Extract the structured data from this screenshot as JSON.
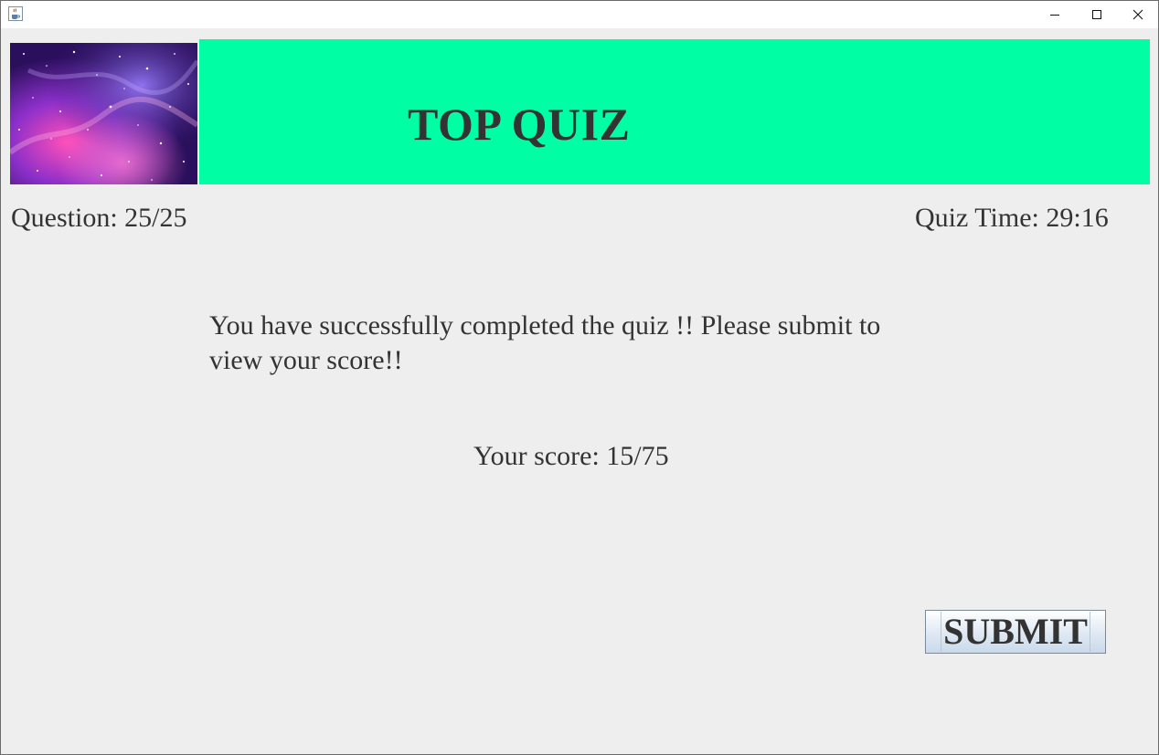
{
  "window": {
    "icons": {
      "app": "java-cup-icon",
      "minimize": "minimize-icon",
      "maximize": "maximize-icon",
      "close": "close-icon"
    }
  },
  "header": {
    "image": "galaxy-nebula-image",
    "title": "TOP QUIZ",
    "banner_color": "#00ffa5"
  },
  "status": {
    "question": "Question: 25/25",
    "timer": "Quiz Time: 29:16"
  },
  "main": {
    "message": "You have successfully completed the quiz !! Please submit to view your score!!",
    "score": "Your score: 15/75"
  },
  "actions": {
    "submit_label": "SUBMIT"
  }
}
